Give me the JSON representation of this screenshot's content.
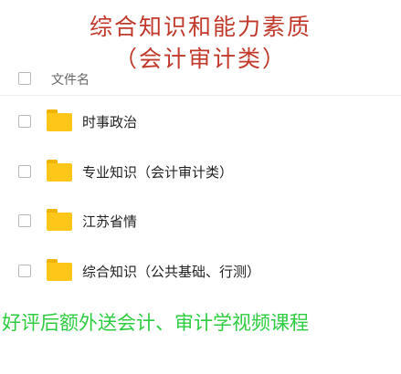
{
  "title": {
    "line1": "综合知识和能力素质",
    "line2": "（会计审计类）"
  },
  "list": {
    "header_label": "文件名",
    "items": [
      {
        "label": "时事政治",
        "icon": "folder-icon"
      },
      {
        "label": "专业知识（会计审计类）",
        "icon": "folder-icon"
      },
      {
        "label": "江苏省情",
        "icon": "folder-icon"
      },
      {
        "label": "综合知识（公共基础、行测）",
        "icon": "folder-icon"
      }
    ]
  },
  "promo": "好评后额外送会计、审计学视频课程",
  "colors": {
    "title": "#c0392b",
    "folder": "#ffc61a",
    "promo": "#2ecc40"
  }
}
